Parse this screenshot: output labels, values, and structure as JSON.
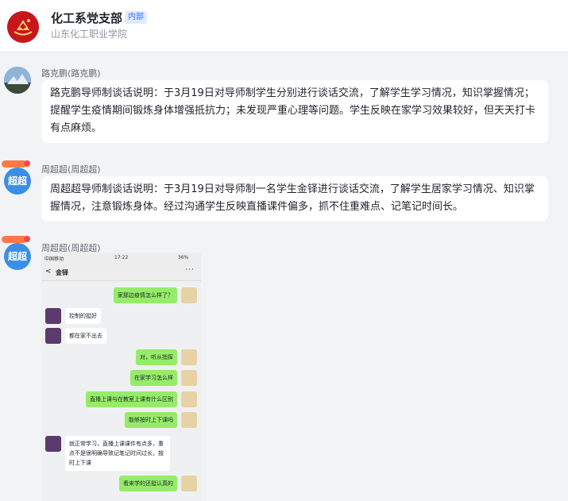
{
  "header": {
    "title": "化工系党支部",
    "badge": "内部",
    "org": "山东化工职业学院",
    "logo_icon": "party-emblem-icon"
  },
  "messages": [
    {
      "sender": "路克鹏(路克鹏)",
      "text": "路克鹏导师制谈话说明：于3月19日对导师制学生分别进行谈话交流，了解学生学习情况，知识掌握情况；提醒学生疫情期间锻炼身体增强抵抗力；未发现严重心理等问题。学生反映在家学习效果较好，但天天打卡有点麻烦。"
    },
    {
      "sender": "周超超(周超超)",
      "avatar_text": "超超",
      "text": "周超超导师制谈话说明：于3月19日对导师制一名学生金铎进行谈话交流，了解学生居家学习情况、知识掌握情况，注意锻炼身体。经过沟通学生反映直播课件偏多，抓不住重难点、记笔记时间长。"
    },
    {
      "sender": "周超超(周超超)",
      "avatar_text": "超超",
      "screenshot": {
        "status_carrier": "中国移动",
        "status_time": "17:22",
        "status_battery": "36%",
        "contact": "金铎",
        "chat": [
          {
            "side": "right",
            "text": "家那边疫情怎么样了？"
          },
          {
            "side": "left",
            "text": "控制的挺好"
          },
          {
            "side": "left",
            "text": "都在家不出去"
          },
          {
            "side": "right",
            "text": "对，听从指挥"
          },
          {
            "side": "right",
            "text": "在家学习怎么样"
          },
          {
            "side": "right",
            "text": "直播上课与在教室上课有什么区别"
          },
          {
            "side": "right",
            "text": "能够按时上下课吗"
          },
          {
            "side": "left",
            "text": "就正常学习，直播上课课件有点多，重点不是很明确导致记笔记时间过长，按时上下课"
          },
          {
            "side": "right",
            "text": "看来学的还挺认真的"
          }
        ]
      }
    }
  ],
  "colors": {
    "accent": "#3370ff",
    "sent_bubble": "#95ec69",
    "background": "#f2f3f5"
  }
}
